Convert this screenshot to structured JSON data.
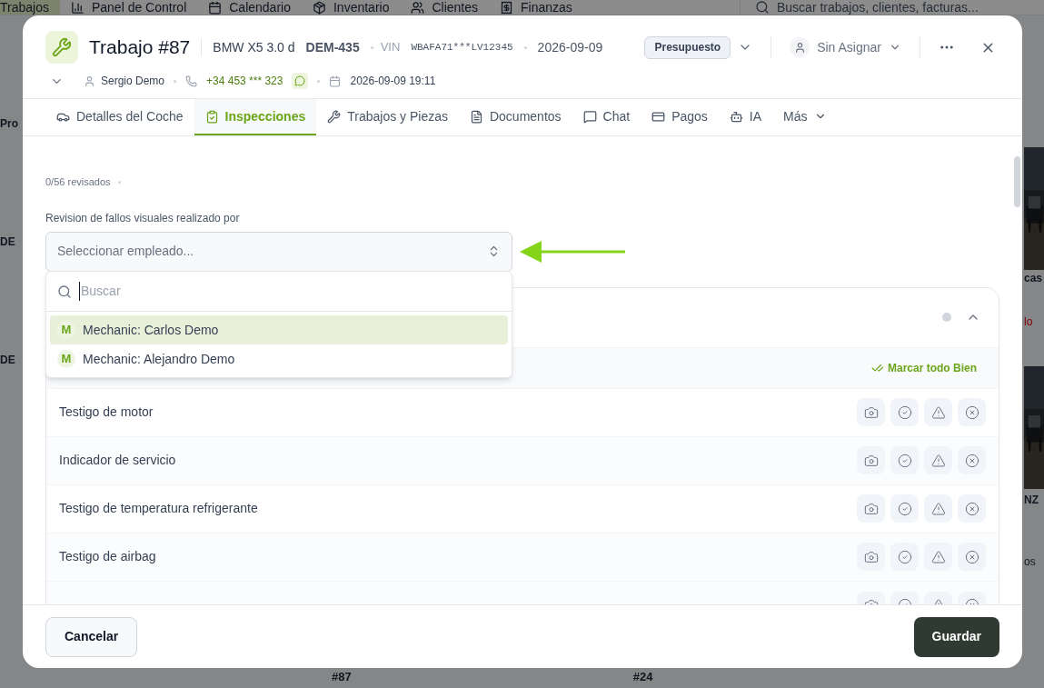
{
  "background_app": {
    "nav": [
      {
        "label": "Trabajos",
        "selected": true
      },
      {
        "label": "Panel de Control",
        "selected": false
      },
      {
        "label": "Calendario",
        "selected": false
      },
      {
        "label": "Inventario",
        "selected": false
      },
      {
        "label": "Clientes",
        "selected": false
      },
      {
        "label": "Finanzas",
        "selected": false
      }
    ],
    "search_placeholder": "Buscar trabajos, clientes, facturas...",
    "left_fragments": [
      "Pro",
      "DE",
      "DE"
    ],
    "right_fragments": [
      "cas",
      "lo",
      "NZ",
      "os"
    ],
    "bottom_fragments": [
      "#87",
      "#24"
    ]
  },
  "job": {
    "title": "Trabajo #87",
    "vehicle": "BMW X5 3.0 d",
    "plate": "DEM-435",
    "vin_label": "VIN",
    "vin": "WBAFA71***LV12345",
    "date": "2026-09-09",
    "status": "Presupuesto",
    "assignee": "Sin Asignar",
    "customer": "Sergio Demo",
    "phone": "+34 453 *** 323",
    "appointment": "2026-09-09 19:11"
  },
  "tabs": [
    {
      "label": "Detalles del Coche",
      "selected": false
    },
    {
      "label": "Inspecciones",
      "selected": true
    },
    {
      "label": "Trabajos y Piezas",
      "selected": false
    },
    {
      "label": "Documentos",
      "selected": false
    },
    {
      "label": "Chat",
      "selected": false
    },
    {
      "label": "Pagos",
      "selected": false
    },
    {
      "label": "IA",
      "selected": false
    },
    {
      "label": "Más",
      "selected": false
    }
  ],
  "inspection": {
    "progress": "0/56 revisados",
    "employee_label": "Revision de fallos visuales realizado por",
    "employee_select": {
      "placeholder": "Seleccionar empleado...",
      "expanded": true
    },
    "dropdown": {
      "search_placeholder": "Buscar",
      "options": [
        {
          "initial": "M",
          "label": "Mechanic: Carlos Demo",
          "selected": true
        },
        {
          "initial": "M",
          "label": "Mechanic: Alejandro Demo",
          "selected": false
        }
      ]
    },
    "mark_all": "Marcar todo Bien",
    "items": [
      {
        "name": "Testigo de motor"
      },
      {
        "name": "Indicador de servicio"
      },
      {
        "name": "Testigo de temperatura refrigerante"
      },
      {
        "name": "Testigo de airbag"
      }
    ],
    "more_below": true
  },
  "footer": {
    "cancel": "Cancelar",
    "save": "Guardar"
  }
}
